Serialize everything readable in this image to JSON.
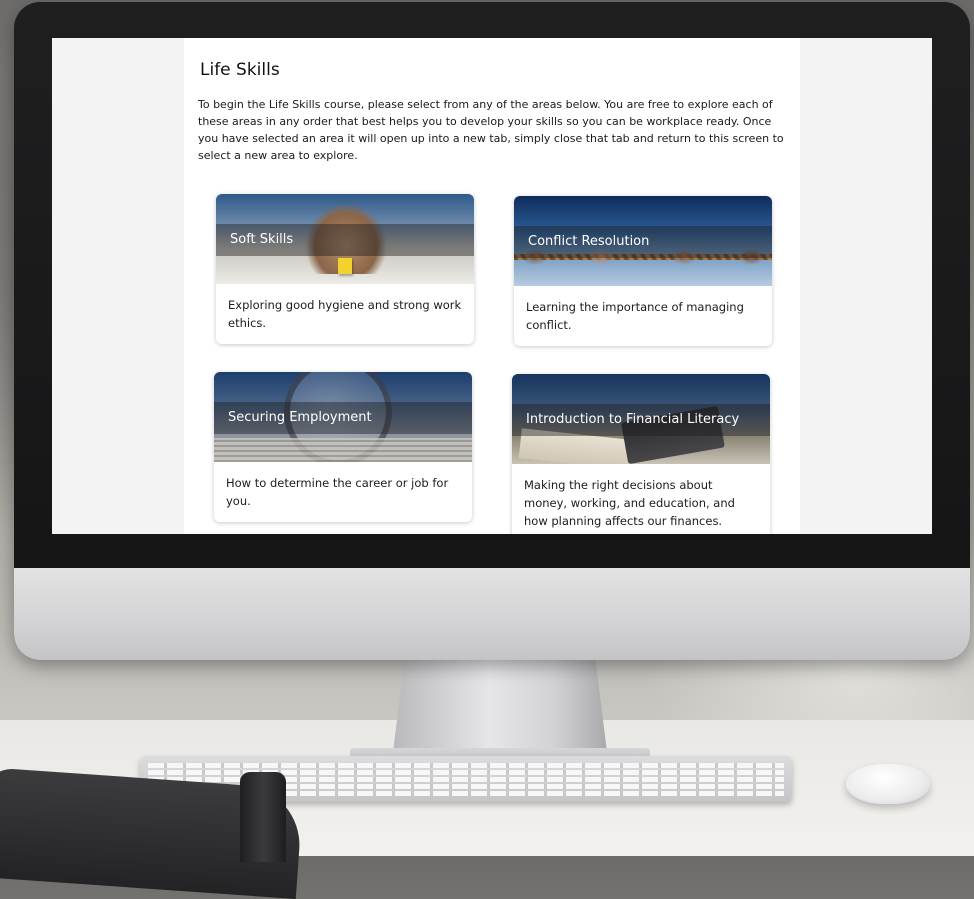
{
  "page": {
    "title": "Life Skills",
    "intro": "To begin the Life Skills course, please select from any of the areas below. You are free to explore each of these areas in any order that best helps you to develop your skills so you can be workplace ready. Once you have selected an area it will open up into a new tab, simply close that tab and return to this screen to select a new area to explore."
  },
  "cards": [
    {
      "label": "Soft Skills",
      "description": "Exploring good hygiene and strong work ethics."
    },
    {
      "label": "Conflict Resolution",
      "description": "Learning the importance of managing conflict."
    },
    {
      "label": "Securing Employment",
      "description": "How to determine the career or job for you."
    },
    {
      "label": "Introduction to Financial Literacy",
      "description": "Making the right decisions about money, working, and education, and how planning affects our finances."
    }
  ]
}
